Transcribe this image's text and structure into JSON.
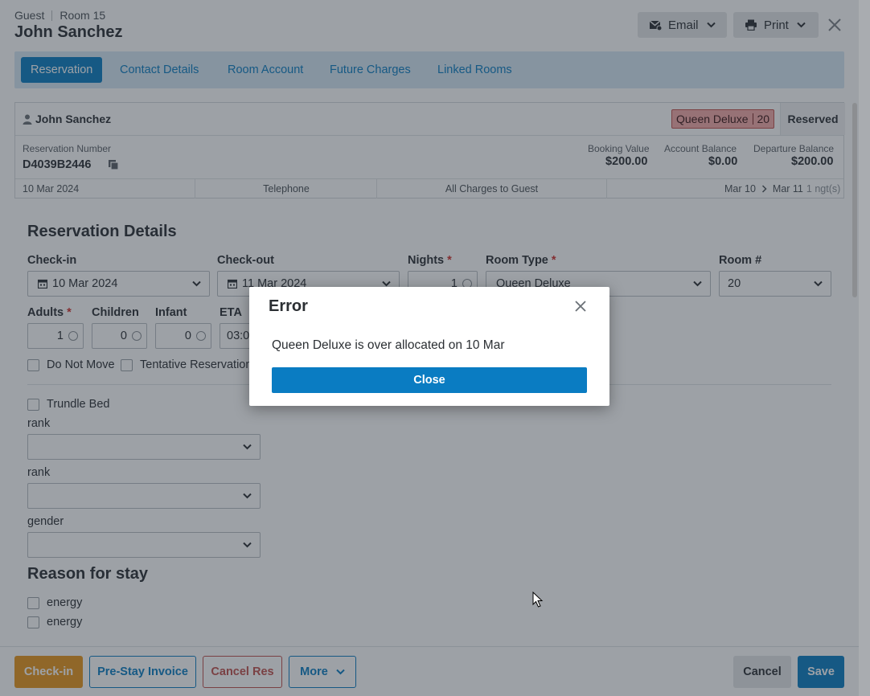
{
  "header": {
    "guest_label": "Guest",
    "room_label": "Room 15",
    "guest_name": "John Sanchez",
    "email_label": "Email",
    "print_label": "Print"
  },
  "tabs": [
    {
      "label": "Reservation",
      "active": true
    },
    {
      "label": "Contact Details"
    },
    {
      "label": "Room Account"
    },
    {
      "label": "Future Charges"
    },
    {
      "label": "Linked Rooms"
    }
  ],
  "summary": {
    "guest_name": "John Sanchez",
    "room_type": "Queen Deluxe",
    "room_number": "20",
    "status": "Reserved",
    "reservation_number_label": "Reservation Number",
    "reservation_number": "D4039B2446",
    "booking_value_label": "Booking Value",
    "booking_value": "$200.00",
    "account_balance_label": "Account Balance",
    "account_balance": "$0.00",
    "departure_balance_label": "Departure Balance",
    "departure_balance": "$200.00",
    "booked_date": "10 Mar 2024",
    "source": "Telephone",
    "billing": "All Charges to Guest",
    "arrival": "Mar 10",
    "departure": "Mar 11",
    "nights": "1 ngt(s)"
  },
  "details": {
    "title": "Reservation Details",
    "checkin_label": "Check-in",
    "checkin_value": "10 Mar 2024",
    "checkout_label": "Check-out",
    "checkout_value": "11 Mar 2024",
    "nights_label": "Nights",
    "nights_value": "1",
    "room_type_label": "Room Type",
    "room_type_value": "Queen Deluxe",
    "room_no_label": "Room #",
    "room_no_value": "20",
    "adults_label": "Adults",
    "adults_value": "1",
    "children_label": "Children",
    "children_value": "0",
    "infant_label": "Infant",
    "infant_value": "0",
    "eta_label": "ETA",
    "eta_value": "03:0",
    "do_not_move": "Do Not Move",
    "tentative": "Tentative Reservation",
    "trundle_bed": "Trundle Bed",
    "rank1_label": "rank",
    "rank2_label": "rank",
    "gender_label": "gender",
    "reason_title": "Reason for stay",
    "reason1": "energy",
    "reason2": "energy"
  },
  "footer": {
    "checkin": "Check-in",
    "prestay": "Pre-Stay Invoice",
    "cancel_res": "Cancel Res",
    "more": "More",
    "cancel": "Cancel",
    "save": "Save"
  },
  "modal": {
    "title": "Error",
    "message": "Queen Deluxe is over allocated on 10 Mar",
    "close_label": "Close"
  },
  "colors": {
    "accent": "#0a7cc2",
    "checkin": "#e8961c",
    "danger": "#c0504d",
    "badge": "#f4a9a8"
  }
}
